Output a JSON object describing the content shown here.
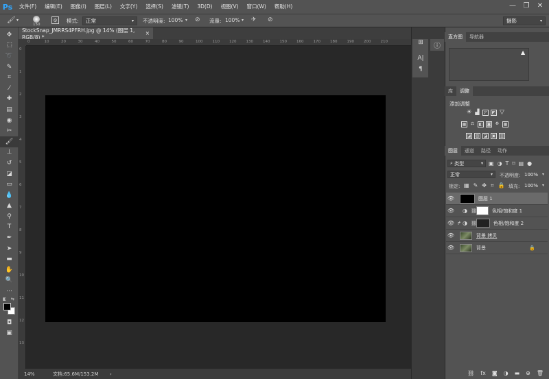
{
  "app": {
    "logo": "Ps"
  },
  "menu": [
    "文件(F)",
    "编辑(E)",
    "图像(I)",
    "图层(L)",
    "文字(Y)",
    "选择(S)",
    "滤镜(T)",
    "3D(D)",
    "视图(V)",
    "窗口(W)",
    "帮助(H)"
  ],
  "window_controls": {
    "minimize": "—",
    "maximize": "❐",
    "close": "✕"
  },
  "options": {
    "brush_size": "150",
    "mode_label": "模式:",
    "mode_value": "正常",
    "opacity_label": "不透明度:",
    "opacity_value": "100%",
    "flow_label": "流量:",
    "flow_value": "100%",
    "workspace": "摄影"
  },
  "document": {
    "tab_title": "StockSnap_JMRRS4PFRH.jpg @ 14% (图层 1, RGB/8) *",
    "tab_close": "×",
    "zoom": "14%",
    "doc_info": "文档:65.6M/153.2M",
    "arrow": "›"
  },
  "ruler_h": [
    "0",
    "10",
    "20",
    "30",
    "40",
    "50",
    "60",
    "70",
    "80",
    "90",
    "100",
    "110",
    "120",
    "130",
    "140",
    "150",
    "160",
    "170",
    "180",
    "190",
    "200",
    "210"
  ],
  "ruler_v": [
    "0",
    "1",
    "2",
    "3",
    "4",
    "5",
    "6",
    "7",
    "8",
    "9",
    "10",
    "11",
    "12",
    "13"
  ],
  "panels": {
    "top_tabs": [
      "直方图",
      "导航器"
    ],
    "warning": "▲",
    "mid_tabs": [
      "库",
      "调整"
    ],
    "adjust_title": "添加调整",
    "layer_tabs": [
      "图层",
      "通道",
      "路径",
      "动作"
    ],
    "filter_kind": "类型",
    "blend_mode": "正常",
    "opacity_label": "不透明度:",
    "opacity_value": "100%",
    "lock_label": "锁定:",
    "fill_label": "填充:",
    "fill_value": "100%"
  },
  "layers": [
    {
      "name": "图层 1",
      "thumb": "#000000",
      "selected": true
    },
    {
      "name": "色相/饱和度 1",
      "thumb": "#ffffff",
      "selected": false
    },
    {
      "name": "色相/饱和度 2",
      "thumb": "#222222",
      "selected": false
    },
    {
      "name": "背景 拷贝",
      "thumb": "#4a5b3c",
      "selected": false
    },
    {
      "name": "背景",
      "thumb": "#4a5b3c",
      "selected": false
    }
  ],
  "colors": {
    "accent": "#31a8ff",
    "panel": "#535353",
    "canvas_bg": "#282828"
  }
}
